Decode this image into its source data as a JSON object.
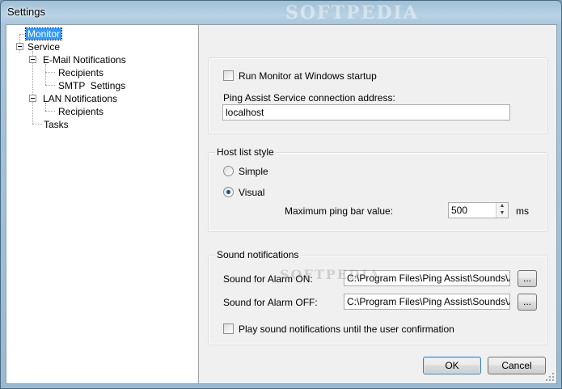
{
  "window": {
    "title": "Settings",
    "watermark": "SOFTPEDIA"
  },
  "tree": {
    "items": [
      {
        "label": "Monitor",
        "selected": true
      },
      {
        "label": "Service"
      },
      {
        "label": "E-Mail Notifications"
      },
      {
        "label": "Recipients"
      },
      {
        "label": "SMTP  Settings"
      },
      {
        "label": "LAN Notifications"
      },
      {
        "label": "Recipients"
      },
      {
        "label": "Tasks"
      }
    ]
  },
  "monitor": {
    "run_at_startup_label": "Run Monitor at Windows startup",
    "run_at_startup_checked": false,
    "connection_label": "Ping Assist Service connection address:",
    "connection_value": "localhost"
  },
  "host_list": {
    "title": "Host list style",
    "simple_label": "Simple",
    "visual_label": "Visual",
    "selected": "Visual",
    "max_ping_label": "Maximum ping bar value:",
    "max_ping_value": "500",
    "max_ping_unit": "ms"
  },
  "sound": {
    "title": "Sound notifications",
    "alarm_on_label": "Sound for Alarm ON:",
    "alarm_on_value": "C:\\Program Files\\Ping Assist\\Sounds\\Alarm",
    "alarm_off_label": "Sound for Alarm OFF:",
    "alarm_off_value": "C:\\Program Files\\Ping Assist\\Sounds\\Alarm",
    "browse_label": "...",
    "play_until_confirm_label": "Play sound notifications until the user confirmation",
    "play_until_confirm_checked": false
  },
  "buttons": {
    "ok": "OK",
    "cancel": "Cancel"
  },
  "colors": {
    "selection": "#3399ff",
    "titlebar": "#a9c6db"
  },
  "icons": [
    "tree-collapse-icon",
    "spin-up-icon",
    "spin-down-icon",
    "size-grip-icon"
  ]
}
